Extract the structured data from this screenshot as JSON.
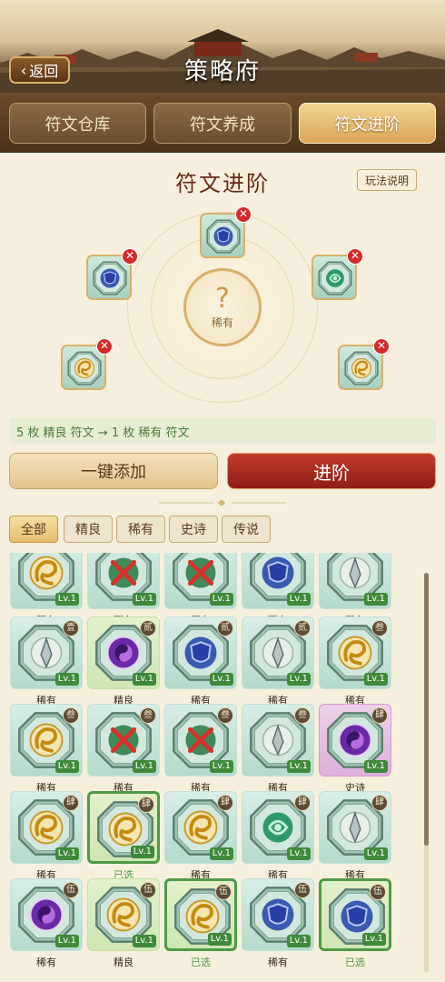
{
  "header": {
    "back_label": "返回",
    "title": "策略府"
  },
  "tabs": [
    {
      "label": "符文仓库",
      "active": false
    },
    {
      "label": "符文养成",
      "active": false
    },
    {
      "label": "符文进阶",
      "active": true
    }
  ],
  "advance": {
    "title": "符文进阶",
    "help_label": "玩法说明",
    "target_symbol": "?",
    "target_rarity": "稀有",
    "slots": [
      {
        "icon": "shield-icon"
      },
      {
        "icon": "shield-icon"
      },
      {
        "icon": "jade-icon"
      },
      {
        "icon": "dragon-icon"
      },
      {
        "icon": "dragon-icon"
      }
    ],
    "remove_symbol": "✕",
    "formula": "5 枚 精良 符文 → 1 枚 稀有 符文",
    "add_all_label": "一键添加",
    "advance_label": "进阶"
  },
  "filters": [
    {
      "label": "全部",
      "active": true
    },
    {
      "label": "精良",
      "active": false
    },
    {
      "label": "稀有",
      "active": false
    },
    {
      "label": "史诗",
      "active": false
    },
    {
      "label": "传说",
      "active": false
    }
  ],
  "runes": [
    {
      "icon": "dragon-icon",
      "badge": "",
      "level": "Lv.1",
      "rarity": "稀有",
      "label": "稀有"
    },
    {
      "icon": "crossed-swords-icon",
      "badge": "",
      "level": "Lv.1",
      "rarity": "稀有",
      "label": "稀有"
    },
    {
      "icon": "crossed-swords-icon",
      "badge": "",
      "level": "Lv.1",
      "rarity": "稀有",
      "label": "稀有"
    },
    {
      "icon": "shield-icon",
      "badge": "",
      "level": "Lv.1",
      "rarity": "稀有",
      "label": "稀有"
    },
    {
      "icon": "spear-icon",
      "badge": "",
      "level": "Lv.1",
      "rarity": "稀有",
      "label": "稀有"
    },
    {
      "icon": "spear-icon",
      "badge": "壹",
      "level": "Lv.1",
      "rarity": "稀有",
      "label": "稀有"
    },
    {
      "icon": "bagua-icon",
      "badge": "贰",
      "level": "Lv.1",
      "rarity": "精良",
      "label": "精良"
    },
    {
      "icon": "shield-icon",
      "badge": "贰",
      "level": "Lv.1",
      "rarity": "稀有",
      "label": "稀有"
    },
    {
      "icon": "spear-icon",
      "badge": "贰",
      "level": "Lv.1",
      "rarity": "稀有",
      "label": "稀有"
    },
    {
      "icon": "dragon-icon",
      "badge": "叁",
      "level": "Lv.1",
      "rarity": "稀有",
      "label": "稀有"
    },
    {
      "icon": "dragon-icon",
      "badge": "叁",
      "level": "Lv.1",
      "rarity": "稀有",
      "label": "稀有"
    },
    {
      "icon": "crossed-swords-icon",
      "badge": "叁",
      "level": "Lv.1",
      "rarity": "稀有",
      "label": "稀有"
    },
    {
      "icon": "crossed-swords-icon",
      "badge": "叁",
      "level": "Lv.1",
      "rarity": "稀有",
      "label": "稀有"
    },
    {
      "icon": "spear-icon",
      "badge": "叁",
      "level": "Lv.1",
      "rarity": "稀有",
      "label": "稀有"
    },
    {
      "icon": "bagua-icon",
      "badge": "肆",
      "level": "Lv.1",
      "rarity": "史诗",
      "label": "史诗"
    },
    {
      "icon": "dragon-icon",
      "badge": "肆",
      "level": "Lv.1",
      "rarity": "稀有",
      "label": "稀有"
    },
    {
      "icon": "dragon-icon",
      "badge": "肆",
      "level": "Lv.1",
      "rarity": "精良",
      "label": "已选",
      "selected": true
    },
    {
      "icon": "dragon-icon",
      "badge": "肆",
      "level": "Lv.1",
      "rarity": "稀有",
      "label": "稀有"
    },
    {
      "icon": "jade-icon",
      "badge": "肆",
      "level": "Lv.1",
      "rarity": "稀有",
      "label": "稀有"
    },
    {
      "icon": "spear-icon",
      "badge": "肆",
      "level": "Lv.1",
      "rarity": "稀有",
      "label": "稀有"
    },
    {
      "icon": "bagua-icon",
      "badge": "伍",
      "level": "Lv.1",
      "rarity": "稀有",
      "label": "稀有"
    },
    {
      "icon": "dragon-icon",
      "badge": "伍",
      "level": "Lv.1",
      "rarity": "精良",
      "label": "精良"
    },
    {
      "icon": "dragon-icon",
      "badge": "伍",
      "level": "Lv.1",
      "rarity": "精良",
      "label": "已选",
      "selected": true
    },
    {
      "icon": "shield-icon",
      "badge": "伍",
      "level": "Lv.1",
      "rarity": "稀有",
      "label": "稀有"
    },
    {
      "icon": "shield-icon",
      "badge": "伍",
      "level": "Lv.1",
      "rarity": "精良",
      "label": "已选",
      "selected": true
    }
  ],
  "colors": {
    "primary_red": "#a8281c",
    "gold": "#d8a656",
    "selected_green": "#4f9a46",
    "level_badge": "#3f8a3a"
  }
}
